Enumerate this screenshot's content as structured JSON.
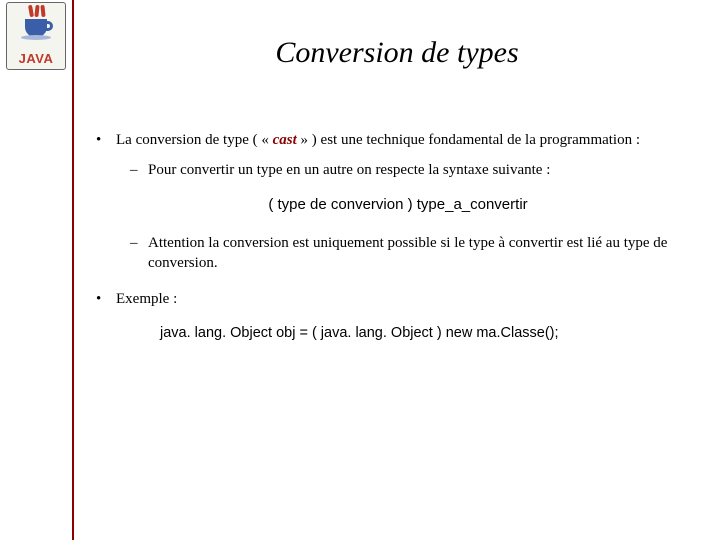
{
  "logo": {
    "text": "JAVA"
  },
  "title": "Conversion de types",
  "bullet1": {
    "prefix": "La conversion de type ( « ",
    "cast": "cast",
    "suffix": " » ) est une technique fondamental de la programmation :",
    "sub1": "Pour convertir un type en un autre on respecte la syntaxe suivante :",
    "syntax": "( type de convervion ) type_a_convertir",
    "sub2": "Attention la conversion est uniquement possible si le type à convertir est lié au type de conversion."
  },
  "bullet2": {
    "label": "Exemple :",
    "code": "java. lang. Object obj = ( java. lang. Object ) new ma.Classe();"
  }
}
